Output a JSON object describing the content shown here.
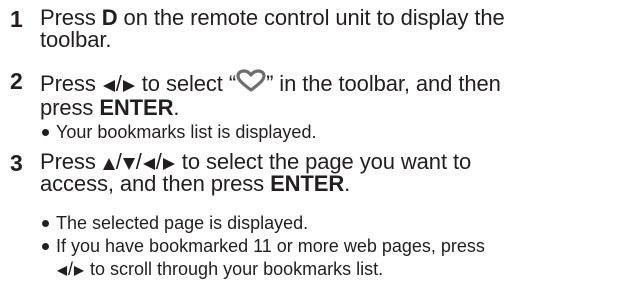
{
  "steps": [
    {
      "number": "1",
      "text_a": "Press ",
      "key": "D",
      "text_b": " on the remote control unit to display the",
      "line2": "toolbar."
    },
    {
      "number": "2",
      "text_a": "Press ",
      "text_b": " to select “",
      "text_c": "” in the toolbar, and then",
      "line2_a": "press ",
      "key": "ENTER",
      "line2_b": ".",
      "bullets": [
        "Your bookmarks list is displayed."
      ]
    },
    {
      "number": "3",
      "text_a": "Press ",
      "text_b": " to select the page you want to",
      "line2_a": "access, and then press ",
      "key": "ENTER",
      "line2_b": ".",
      "bullets": [
        "The selected page is displayed.",
        "If you have bookmarked 11 or more web pages, press",
        " to scroll through your bookmarks list."
      ]
    }
  ],
  "icons": {
    "arrow_left": "left-triangle-icon",
    "arrow_right": "right-triangle-icon",
    "arrow_up": "up-triangle-icon",
    "arrow_down": "down-triangle-icon",
    "heart": "heart-outline-icon",
    "heart_color": "#6d6e71"
  },
  "separator": "/"
}
